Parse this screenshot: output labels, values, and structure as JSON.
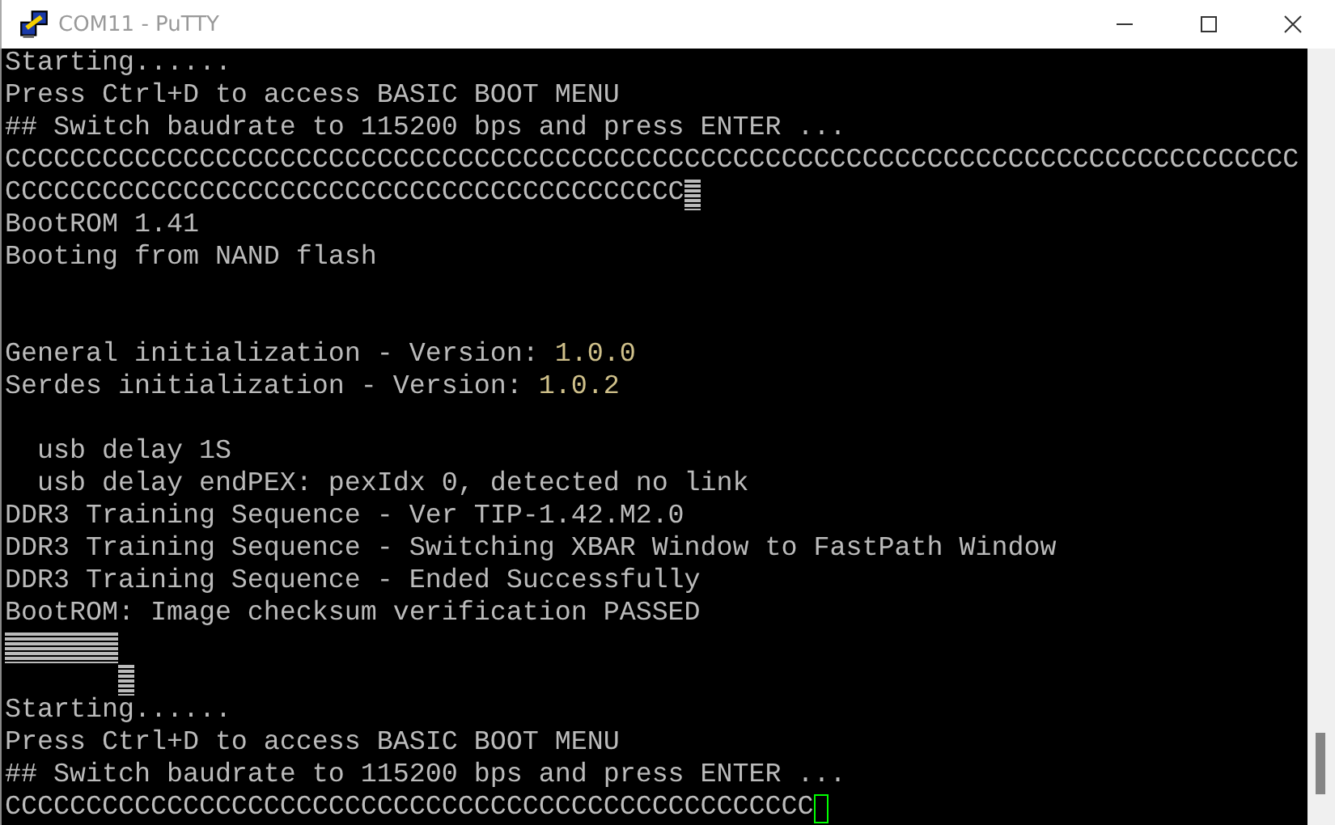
{
  "window": {
    "title": "COM11 - PuTTY"
  },
  "terminal": {
    "lines": [
      {
        "text": "Starting......"
      },
      {
        "text": "Press Ctrl+D to access BASIC BOOT MENU"
      },
      {
        "text": "## Switch baudrate to 115200 bps and press ENTER ..."
      },
      {
        "text": "CCCCCCCCCCCCCCCCCCCCCCCCCCCCCCCCCCCCCCCCCCCCCCCCCCCCCCCCCCCCCCCCCCCCCCCCCCCCCCCC"
      },
      {
        "parts": [
          {
            "kind": "text",
            "text": "CCCCCCCCCCCCCCCCCCCCCCCCCCCCCCCCCCCCCCCCCC"
          },
          {
            "kind": "garbled"
          }
        ]
      },
      {
        "text": "BootROM 1.41"
      },
      {
        "text": "Booting from NAND flash"
      },
      {
        "kind": "blank"
      },
      {
        "kind": "blank"
      },
      {
        "parts": [
          {
            "kind": "text",
            "text": "General initialization - Version: "
          },
          {
            "kind": "text",
            "text": "1.0.0",
            "color": "#cfc08a"
          }
        ]
      },
      {
        "parts": [
          {
            "kind": "text",
            "text": "Serdes initialization - Version: "
          },
          {
            "kind": "text",
            "text": "1.0.2",
            "color": "#cfc08a"
          }
        ]
      },
      {
        "kind": "blank"
      },
      {
        "text": "  usb delay 1S"
      },
      {
        "text": "  usb delay endPEX: pexIdx 0, detected no link"
      },
      {
        "text": "DDR3 Training Sequence - Ver TIP-1.42.M2.0"
      },
      {
        "text": "DDR3 Training Sequence - Switching XBAR Window to FastPath Window"
      },
      {
        "text": "DDR3 Training Sequence - Ended Successfully"
      },
      {
        "text": "BootROM: Image checksum verification PASSED"
      },
      {
        "parts": [
          {
            "kind": "garbled"
          },
          {
            "kind": "garbled"
          },
          {
            "kind": "garbled"
          },
          {
            "kind": "garbled"
          },
          {
            "kind": "garbled"
          },
          {
            "kind": "garbled"
          },
          {
            "kind": "garbled"
          }
        ]
      },
      {
        "parts": [
          {
            "kind": "blank"
          },
          {
            "kind": "blank"
          },
          {
            "kind": "blank"
          },
          {
            "kind": "blank"
          },
          {
            "kind": "blank"
          },
          {
            "kind": "blank"
          },
          {
            "kind": "blank"
          },
          {
            "kind": "garbled"
          }
        ]
      },
      {
        "text": "Starting......"
      },
      {
        "text": "Press Ctrl+D to access BASIC BOOT MENU"
      },
      {
        "text": "## Switch baudrate to 115200 bps and press ENTER ..."
      },
      {
        "text": "CCCCCCCCCCCCCCCCCCCCCCCCCCCCCCCCCCCCCCCCCCCCCCCCCC",
        "cursor": true
      }
    ]
  }
}
